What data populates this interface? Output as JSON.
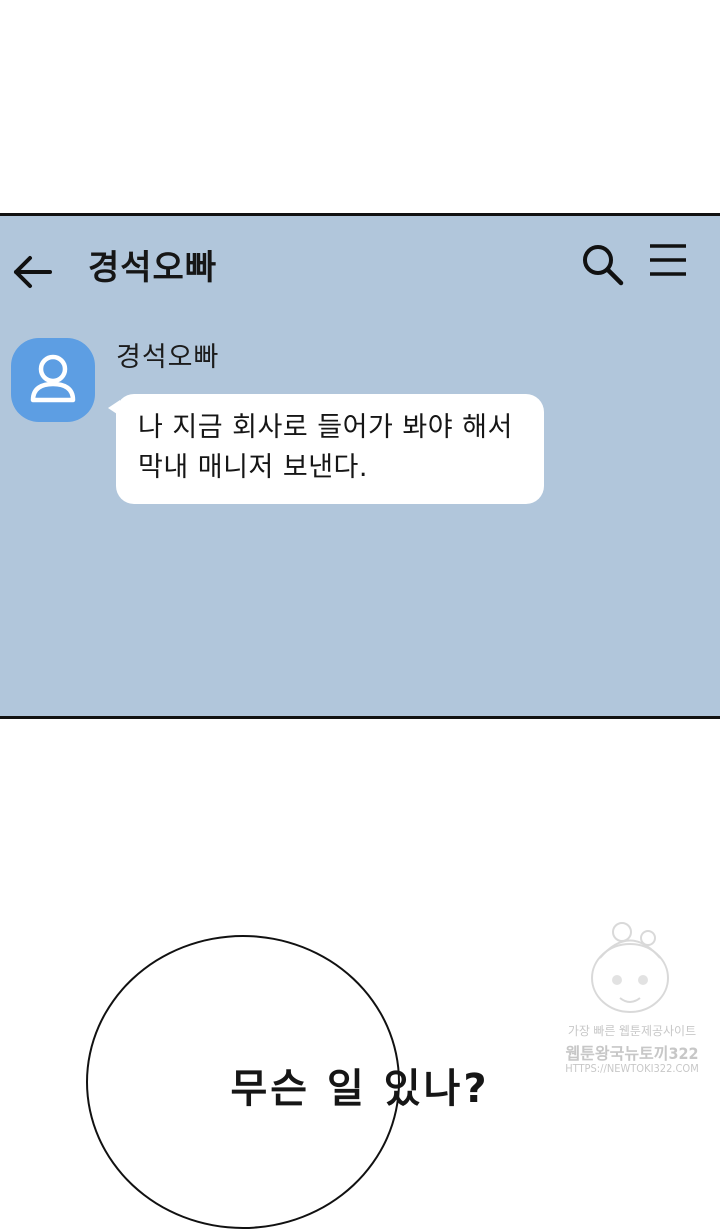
{
  "chat": {
    "title": "경석오빠",
    "sender_name": "경석오빠",
    "message_lines": [
      "나 지금 회사로 들어가 봐야 해서",
      "막내 매니저 보낸다."
    ]
  },
  "speech_bubble": {
    "text": "무슨 일 있나?"
  },
  "watermark": {
    "line1": "가장 빠른 웹툰제공사이트",
    "line2": "웹툰왕국뉴토끼322",
    "line3": "HTTPS://NEWTOKI322.COM"
  },
  "icons": {
    "back": "arrow-left-icon",
    "search": "search-icon",
    "menu": "hamburger-menu-icon",
    "avatar": "user-icon"
  },
  "colors": {
    "chat_background": "#b1c6db",
    "avatar": "#5d9ee3",
    "bubble": "#ffffff"
  }
}
